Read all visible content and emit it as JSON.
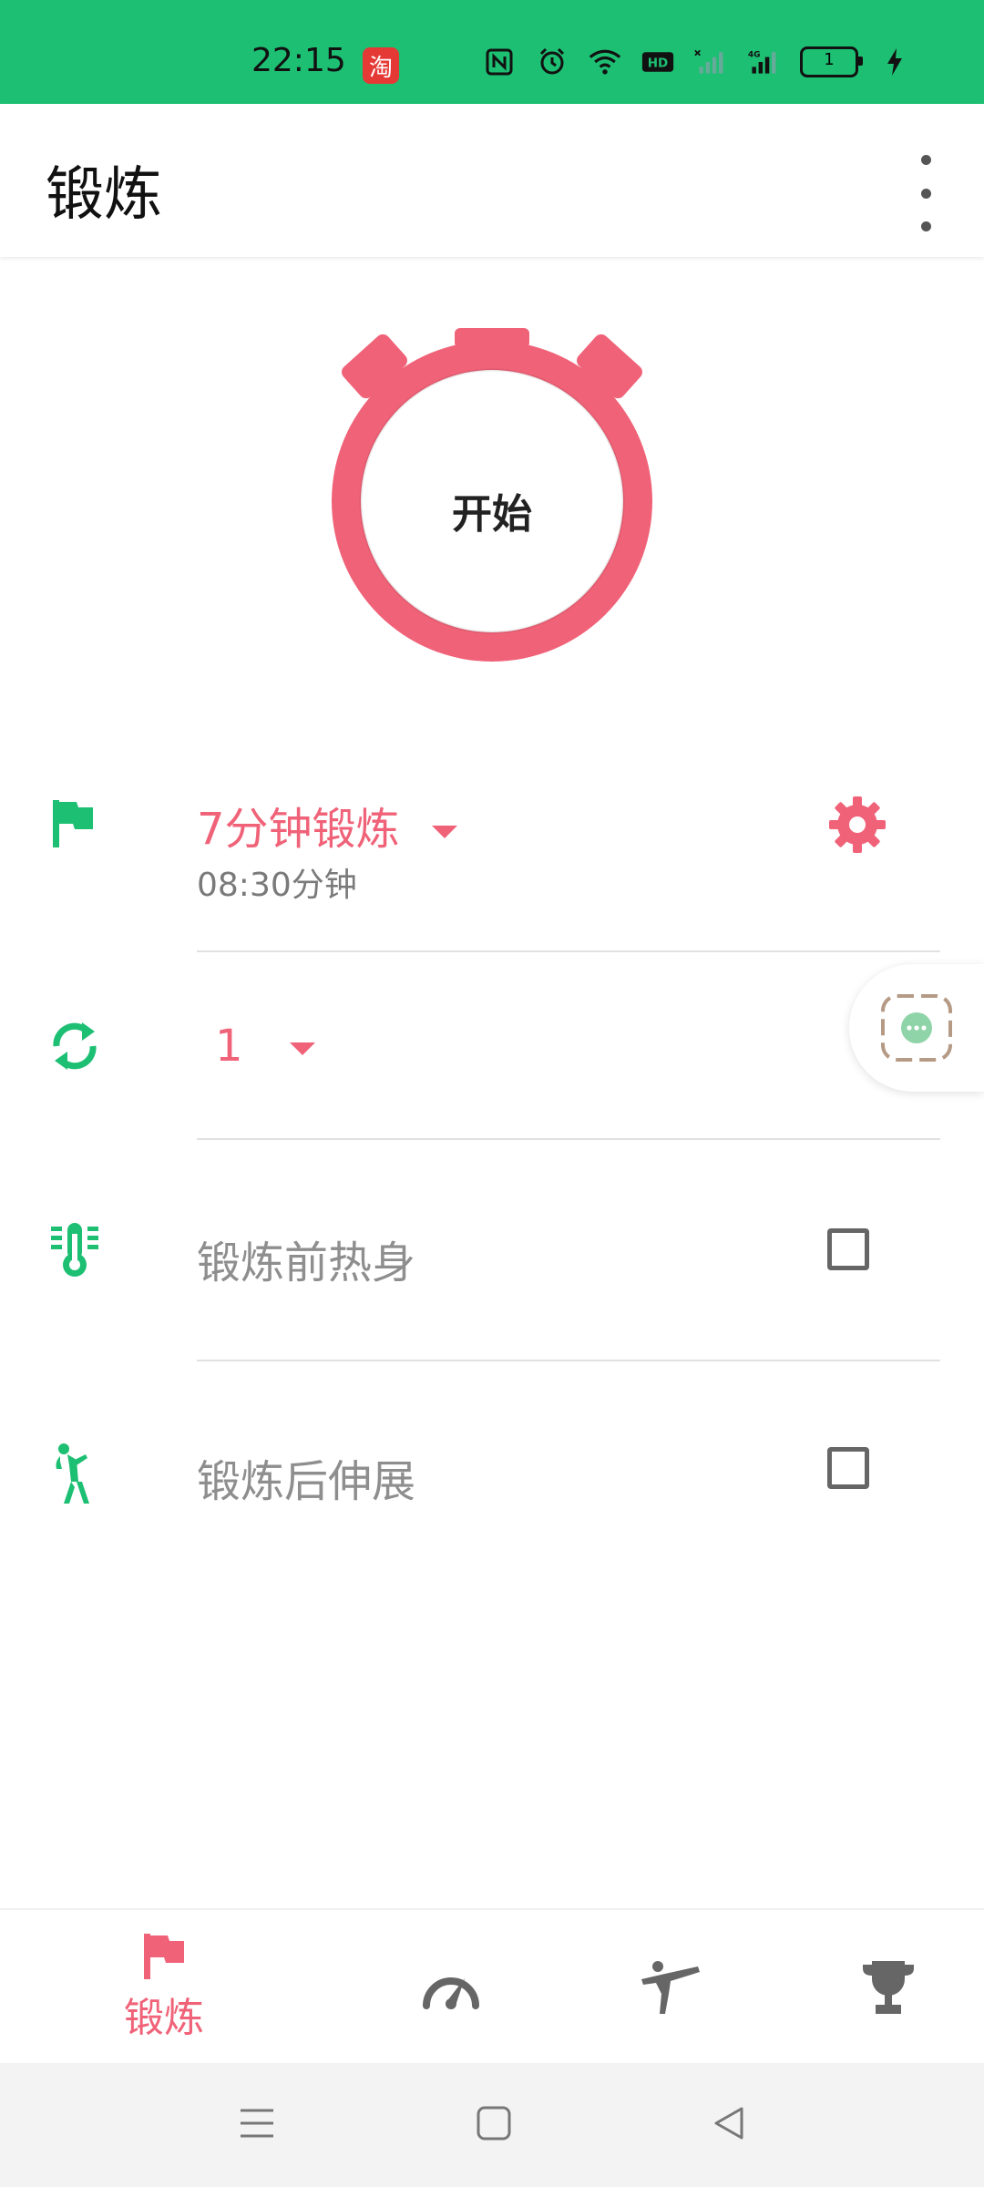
{
  "status_bar": {
    "time": "22:15",
    "app_badge": "淘",
    "battery_level": "1",
    "icons": [
      "nfc-icon",
      "alarm-icon",
      "wifi-icon",
      "hd-icon",
      "signal-icon",
      "4g-signal-icon",
      "battery-icon",
      "charging-icon"
    ]
  },
  "app_bar": {
    "title": "锻炼"
  },
  "stopwatch": {
    "start_label": "开始"
  },
  "workout": {
    "title": "7分钟锻炼",
    "duration": "08:30分钟"
  },
  "rounds": {
    "value": "1"
  },
  "options": {
    "warmup_label": "锻炼前热身",
    "warmup_checked": false,
    "stretch_label": "锻炼后伸展",
    "stretch_checked": false
  },
  "bottom_nav": {
    "items": [
      {
        "label": "锻炼",
        "icon": "flag-icon",
        "active": true
      },
      {
        "label": "",
        "icon": "speedometer-icon",
        "active": false
      },
      {
        "label": "",
        "icon": "martial-arts-icon",
        "active": false
      },
      {
        "label": "",
        "icon": "trophy-icon",
        "active": false
      }
    ]
  },
  "colors": {
    "accent": "#F06278",
    "primary_green": "#1DBF73",
    "status_bar": "#1DBF73"
  }
}
